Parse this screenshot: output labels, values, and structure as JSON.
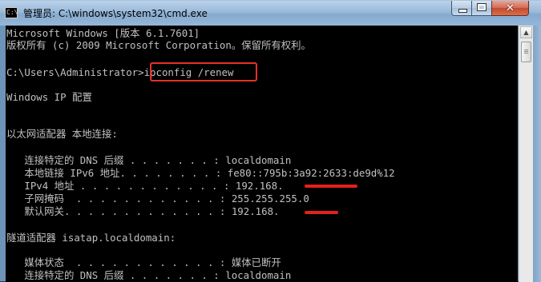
{
  "window": {
    "title": "管理员: C:\\windows\\system32\\cmd.exe",
    "app_icon_text": "C:\\",
    "close_glyph": "✕"
  },
  "console": {
    "lines": [
      "Microsoft Windows [版本 6.1.7601]",
      "版权所有 (c) 2009 Microsoft Corporation。保留所有权利。",
      "",
      "C:\\Users\\Administrator>ipconfig /renew",
      "",
      "Windows IP 配置",
      "",
      "",
      "以太网适配器 本地连接:",
      "",
      "   连接特定的 DNS 后缀 . . . . . . . : localdomain",
      "   本地链接 IPv6 地址. . . . . . . . : fe80::795b:3a92:2633:de9d%12",
      "   IPv4 地址 . . . . . . . . . . . . : 192.168.",
      "   子网掩码  . . . . . . . . . . . . : 255.255.255.0",
      "   默认网关. . . . . . . . . . . . . : 192.168.",
      "",
      "隧道适配器 isatap.localdomain:",
      "",
      "   媒体状态  . . . . . . . . . . . . : 媒体已断开",
      "   连接特定的 DNS 后缀 . . . . . . . : localdomain"
    ]
  },
  "colors": {
    "console_bg": "#000000",
    "console_text": "#c0c0c0",
    "annotation_red": "#e8302a"
  }
}
